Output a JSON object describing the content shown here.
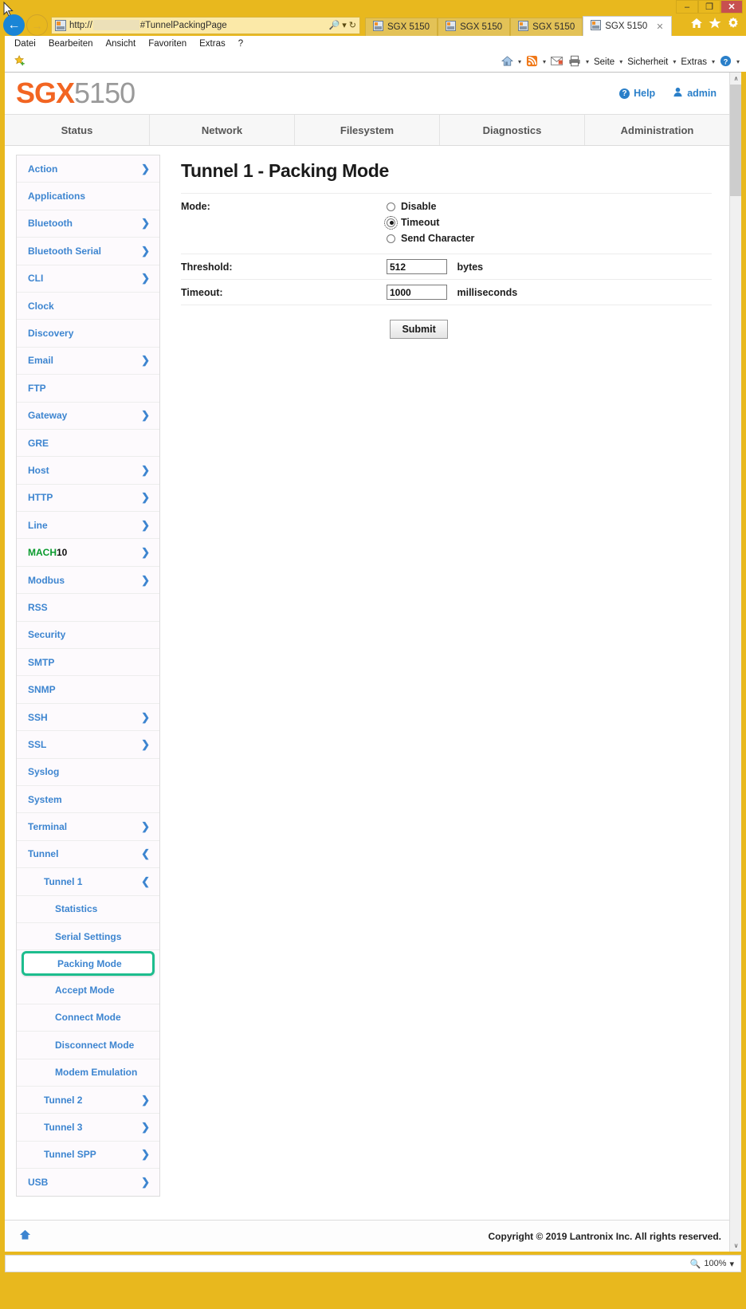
{
  "browser": {
    "window_controls": {
      "minimize": "–",
      "maximize": "❐",
      "close": "✕"
    },
    "nav": {
      "back": "←",
      "forward": "→"
    },
    "address": {
      "scheme_text": "http://",
      "redacted": "",
      "fragment": "#TunnelPackingPage",
      "search_icon": "search-icon",
      "dropdown": "▾",
      "refresh": "↻"
    },
    "tabs": [
      {
        "label": "SGX 5150",
        "active": false
      },
      {
        "label": "SGX 5150",
        "active": false
      },
      {
        "label": "SGX 5150",
        "active": false
      },
      {
        "label": "SGX 5150",
        "active": true,
        "close": "✕"
      }
    ],
    "chrome_icons": [
      "home-icon",
      "favorites-star-icon",
      "tools-gear-icon"
    ],
    "menu": [
      "Datei",
      "Bearbeiten",
      "Ansicht",
      "Favoriten",
      "Extras",
      "?"
    ],
    "command_bar": {
      "left_icon": "favorites-add-icon",
      "items": [
        {
          "label": "",
          "icon": "home-icon",
          "caret": "▾"
        },
        {
          "label": "",
          "icon": "rss-feed-icon",
          "caret": "▾"
        },
        {
          "label": "",
          "icon": "mail-icon",
          "caret": ""
        },
        {
          "label": "",
          "icon": "print-icon",
          "caret": "▾"
        },
        {
          "label": "Seite",
          "icon": "",
          "caret": "▾"
        },
        {
          "label": "Sicherheit",
          "icon": "",
          "caret": "▾"
        },
        {
          "label": "Extras",
          "icon": "",
          "caret": "▾"
        },
        {
          "label": "",
          "icon": "help-icon",
          "caret": "▾"
        }
      ]
    },
    "status_bar": {
      "zoom_level": "100%",
      "zoom_caret": "▾"
    }
  },
  "header": {
    "brand_primary": "SGX",
    "brand_secondary": "5150",
    "help_label": "Help",
    "help_icon_glyph": "?",
    "user_label": "admin",
    "scroll_up_glyph": "∧"
  },
  "topnav": [
    {
      "label": "Status"
    },
    {
      "label": "Network"
    },
    {
      "label": "Filesystem"
    },
    {
      "label": "Diagnostics"
    },
    {
      "label": "Administration"
    }
  ],
  "sidebar": {
    "chevron_right": "❯",
    "chevron_left": "❮",
    "items": [
      {
        "label": "Action",
        "level": 1,
        "expandable": true,
        "expanded": false
      },
      {
        "label": "Applications",
        "level": 1,
        "expandable": false
      },
      {
        "label": "Bluetooth",
        "level": 1,
        "expandable": true,
        "expanded": false
      },
      {
        "label": "Bluetooth Serial",
        "level": 1,
        "expandable": true,
        "expanded": false
      },
      {
        "label": "CLI",
        "level": 1,
        "expandable": true,
        "expanded": false
      },
      {
        "label": "Clock",
        "level": 1,
        "expandable": false
      },
      {
        "label": "Discovery",
        "level": 1,
        "expandable": false
      },
      {
        "label": "Email",
        "level": 1,
        "expandable": true,
        "expanded": false
      },
      {
        "label": "FTP",
        "level": 1,
        "expandable": false
      },
      {
        "label": "Gateway",
        "level": 1,
        "expandable": true,
        "expanded": false
      },
      {
        "label": "GRE",
        "level": 1,
        "expandable": false
      },
      {
        "label": "Host",
        "level": 1,
        "expandable": true,
        "expanded": false
      },
      {
        "label": "HTTP",
        "level": 1,
        "expandable": true,
        "expanded": false
      },
      {
        "label": "Line",
        "level": 1,
        "expandable": true,
        "expanded": false
      },
      {
        "label": "MACH10",
        "level": 1,
        "expandable": true,
        "expanded": false,
        "style": "mach",
        "part_green": "MACH",
        "part_black": "10"
      },
      {
        "label": "Modbus",
        "level": 1,
        "expandable": true,
        "expanded": false
      },
      {
        "label": "RSS",
        "level": 1,
        "expandable": false
      },
      {
        "label": "Security",
        "level": 1,
        "expandable": false
      },
      {
        "label": "SMTP",
        "level": 1,
        "expandable": false
      },
      {
        "label": "SNMP",
        "level": 1,
        "expandable": false
      },
      {
        "label": "SSH",
        "level": 1,
        "expandable": true,
        "expanded": false
      },
      {
        "label": "SSL",
        "level": 1,
        "expandable": true,
        "expanded": false
      },
      {
        "label": "Syslog",
        "level": 1,
        "expandable": false
      },
      {
        "label": "System",
        "level": 1,
        "expandable": false
      },
      {
        "label": "Terminal",
        "level": 1,
        "expandable": true,
        "expanded": false
      },
      {
        "label": "Tunnel",
        "level": 1,
        "expandable": true,
        "expanded": true
      },
      {
        "label": "Tunnel 1",
        "level": 2,
        "expandable": true,
        "expanded": true
      },
      {
        "label": "Statistics",
        "level": 3,
        "expandable": false
      },
      {
        "label": "Serial Settings",
        "level": 3,
        "expandable": false
      },
      {
        "label": "Packing Mode",
        "level": 3,
        "expandable": false,
        "selected": true
      },
      {
        "label": "Accept Mode",
        "level": 3,
        "expandable": false
      },
      {
        "label": "Connect Mode",
        "level": 3,
        "expandable": false
      },
      {
        "label": "Disconnect Mode",
        "level": 3,
        "expandable": false
      },
      {
        "label": "Modem Emulation",
        "level": 3,
        "expandable": false
      },
      {
        "label": "Tunnel 2",
        "level": 2,
        "expandable": true,
        "expanded": false
      },
      {
        "label": "Tunnel 3",
        "level": 2,
        "expandable": true,
        "expanded": false
      },
      {
        "label": "Tunnel SPP",
        "level": 2,
        "expandable": true,
        "expanded": false
      },
      {
        "label": "USB",
        "level": 1,
        "expandable": true,
        "expanded": false
      }
    ]
  },
  "main": {
    "title": "Tunnel 1 - Packing Mode",
    "fields": {
      "mode_label": "Mode:",
      "mode_options": [
        {
          "label": "Disable",
          "selected": false
        },
        {
          "label": "Timeout",
          "selected": true
        },
        {
          "label": "Send Character",
          "selected": false
        }
      ],
      "threshold_label": "Threshold:",
      "threshold_value": "512",
      "threshold_unit": "bytes",
      "timeout_label": "Timeout:",
      "timeout_value": "1000",
      "timeout_unit": "milliseconds"
    },
    "submit_label": "Submit"
  },
  "footer": {
    "home_icon": "home-icon",
    "copyright": "Copyright © 2019 Lantronix Inc. All rights reserved.",
    "scroll_down_glyph": "∨"
  },
  "colors": {
    "chrome_yellow": "#e8b81e",
    "brand_orange": "#f26522",
    "brand_gray": "#9a9a9a",
    "link_blue": "#3d85d0",
    "highlight_green": "#1dbd8e",
    "mach_green": "#0a9b2e"
  }
}
